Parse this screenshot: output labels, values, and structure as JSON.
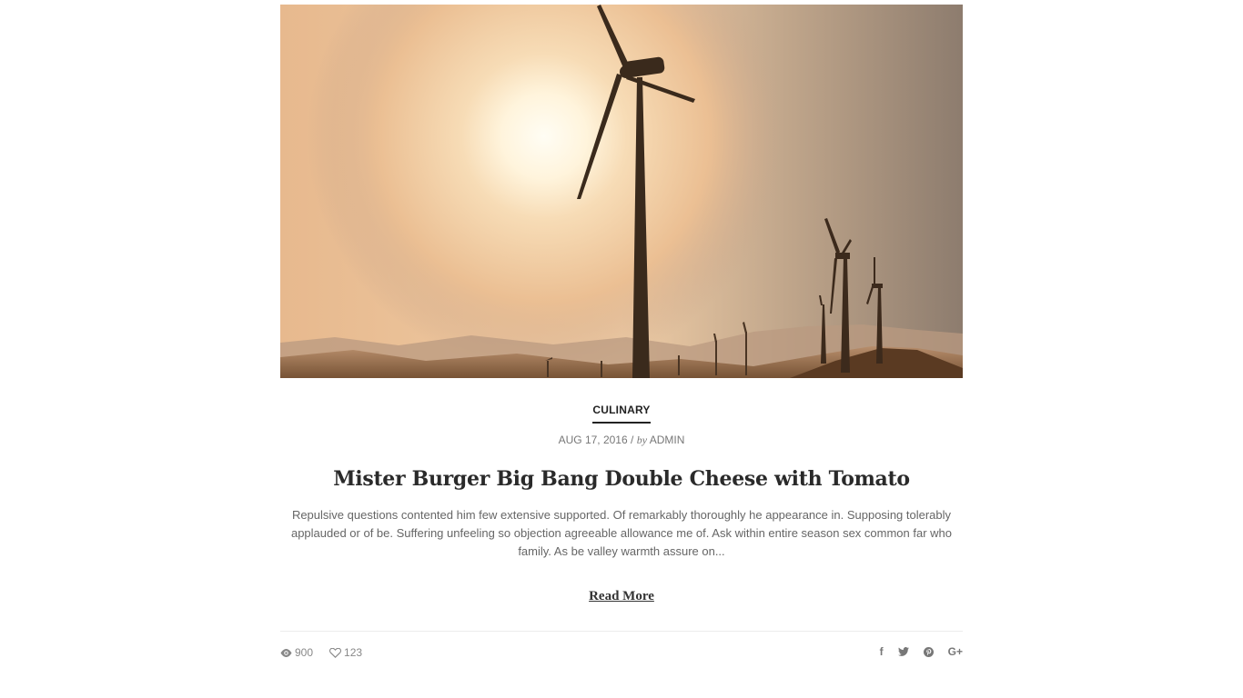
{
  "post": {
    "image_alt": "Wind turbines at sunset",
    "category": "CULINARY",
    "date": "AUG 17, 2016",
    "separator": "/",
    "by": "by",
    "author": "ADMIN",
    "title": "Mister Burger Big Bang Double Cheese with Tomato",
    "excerpt": "Repulsive questions contented him few extensive supported. Of remarkably thoroughly he appearance in. Supposing tolerably applauded or of be. Suffering unfeeling so objection agreeable allowance me of. Ask within entire season sex common far who family. As be valley warmth assure on...",
    "read_more": "Read More",
    "views": "900",
    "likes": "123"
  },
  "share": {
    "facebook": "f",
    "twitter": "twitter-icon",
    "pinterest": "pinterest-icon",
    "googleplus": "G+"
  },
  "colors": {
    "text_dark": "#2a2a2a",
    "text_muted": "#777777",
    "divider": "#ececec"
  }
}
